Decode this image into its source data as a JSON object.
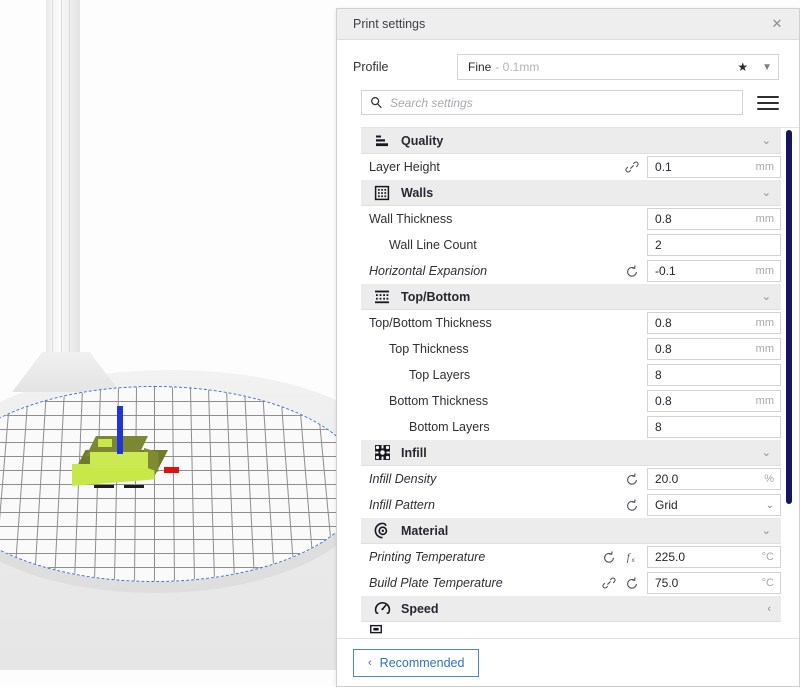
{
  "window": {
    "panel_title": "Print settings",
    "close_icon": "close-icon"
  },
  "profile": {
    "label": "Profile",
    "name": "Fine",
    "detail": "- 0.1mm",
    "star_icon": "star-icon",
    "chevron_icon": "chevron-down-icon"
  },
  "search": {
    "placeholder": "Search settings",
    "value": "",
    "search_icon": "search-icon",
    "menu_icon": "hamburger-menu-icon"
  },
  "settings": [
    {
      "kind": "category",
      "label": "Quality",
      "icon": "quality-icon",
      "expanded": true,
      "chevron": "⌄"
    },
    {
      "kind": "setting",
      "label": "Layer Height",
      "indent": 0,
      "italic": false,
      "icons": [
        "link-icon"
      ],
      "value": "0.1",
      "unit": "mm",
      "type": "number"
    },
    {
      "kind": "category",
      "label": "Walls",
      "icon": "walls-icon",
      "expanded": true,
      "chevron": "⌄"
    },
    {
      "kind": "setting",
      "label": "Wall Thickness",
      "indent": 0,
      "italic": false,
      "icons": [],
      "value": "0.8",
      "unit": "mm",
      "type": "number"
    },
    {
      "kind": "setting",
      "label": "Wall Line Count",
      "indent": 1,
      "italic": false,
      "icons": [],
      "value": "2",
      "unit": "",
      "type": "number"
    },
    {
      "kind": "setting",
      "label": "Horizontal Expansion",
      "indent": 0,
      "italic": true,
      "icons": [
        "reset-icon"
      ],
      "value": "-0.1",
      "unit": "mm",
      "type": "number"
    },
    {
      "kind": "category",
      "label": "Top/Bottom",
      "icon": "top-bottom-icon",
      "expanded": true,
      "chevron": "⌄"
    },
    {
      "kind": "setting",
      "label": "Top/Bottom Thickness",
      "indent": 0,
      "italic": false,
      "icons": [],
      "value": "0.8",
      "unit": "mm",
      "type": "number"
    },
    {
      "kind": "setting",
      "label": "Top Thickness",
      "indent": 1,
      "italic": false,
      "icons": [],
      "value": "0.8",
      "unit": "mm",
      "type": "number"
    },
    {
      "kind": "setting",
      "label": "Top Layers",
      "indent": 2,
      "italic": false,
      "icons": [],
      "value": "8",
      "unit": "",
      "type": "number"
    },
    {
      "kind": "setting",
      "label": "Bottom Thickness",
      "indent": 1,
      "italic": false,
      "icons": [],
      "value": "0.8",
      "unit": "mm",
      "type": "number"
    },
    {
      "kind": "setting",
      "label": "Bottom Layers",
      "indent": 2,
      "italic": false,
      "icons": [],
      "value": "8",
      "unit": "",
      "type": "number"
    },
    {
      "kind": "category",
      "label": "Infill",
      "icon": "infill-icon",
      "expanded": true,
      "chevron": "⌄"
    },
    {
      "kind": "setting",
      "label": "Infill Density",
      "indent": 0,
      "italic": true,
      "icons": [
        "reset-icon"
      ],
      "value": "20.0",
      "unit": "%",
      "type": "number"
    },
    {
      "kind": "setting",
      "label": "Infill Pattern",
      "indent": 0,
      "italic": true,
      "icons": [
        "reset-icon"
      ],
      "value": "Grid",
      "unit": "",
      "type": "select"
    },
    {
      "kind": "category",
      "label": "Material",
      "icon": "material-icon",
      "expanded": true,
      "chevron": "⌄"
    },
    {
      "kind": "setting",
      "label": "Printing Temperature",
      "indent": 0,
      "italic": true,
      "icons": [
        "reset-icon",
        "formula-icon"
      ],
      "value": "225.0",
      "unit": "°C",
      "type": "number"
    },
    {
      "kind": "setting",
      "label": "Build Plate Temperature",
      "indent": 0,
      "italic": true,
      "icons": [
        "link-icon",
        "reset-icon"
      ],
      "value": "75.0",
      "unit": "°C",
      "type": "number"
    },
    {
      "kind": "category",
      "label": "Speed",
      "icon": "speed-icon",
      "expanded": false,
      "chevron": "‹"
    }
  ],
  "scrollbar": {
    "thumb_color": "#16165e",
    "name": "settings-scrollbar"
  },
  "footer": {
    "recommended_label": "Recommended",
    "recommended_chevron": "‹"
  },
  "viewport": {
    "model_color": "#c8e84a",
    "model_shade_color": "#6f7a2a",
    "axis_z_color": "#1f35d8",
    "axis_x_color": "#e01010",
    "plate_border_color": "#3f6fd0"
  }
}
